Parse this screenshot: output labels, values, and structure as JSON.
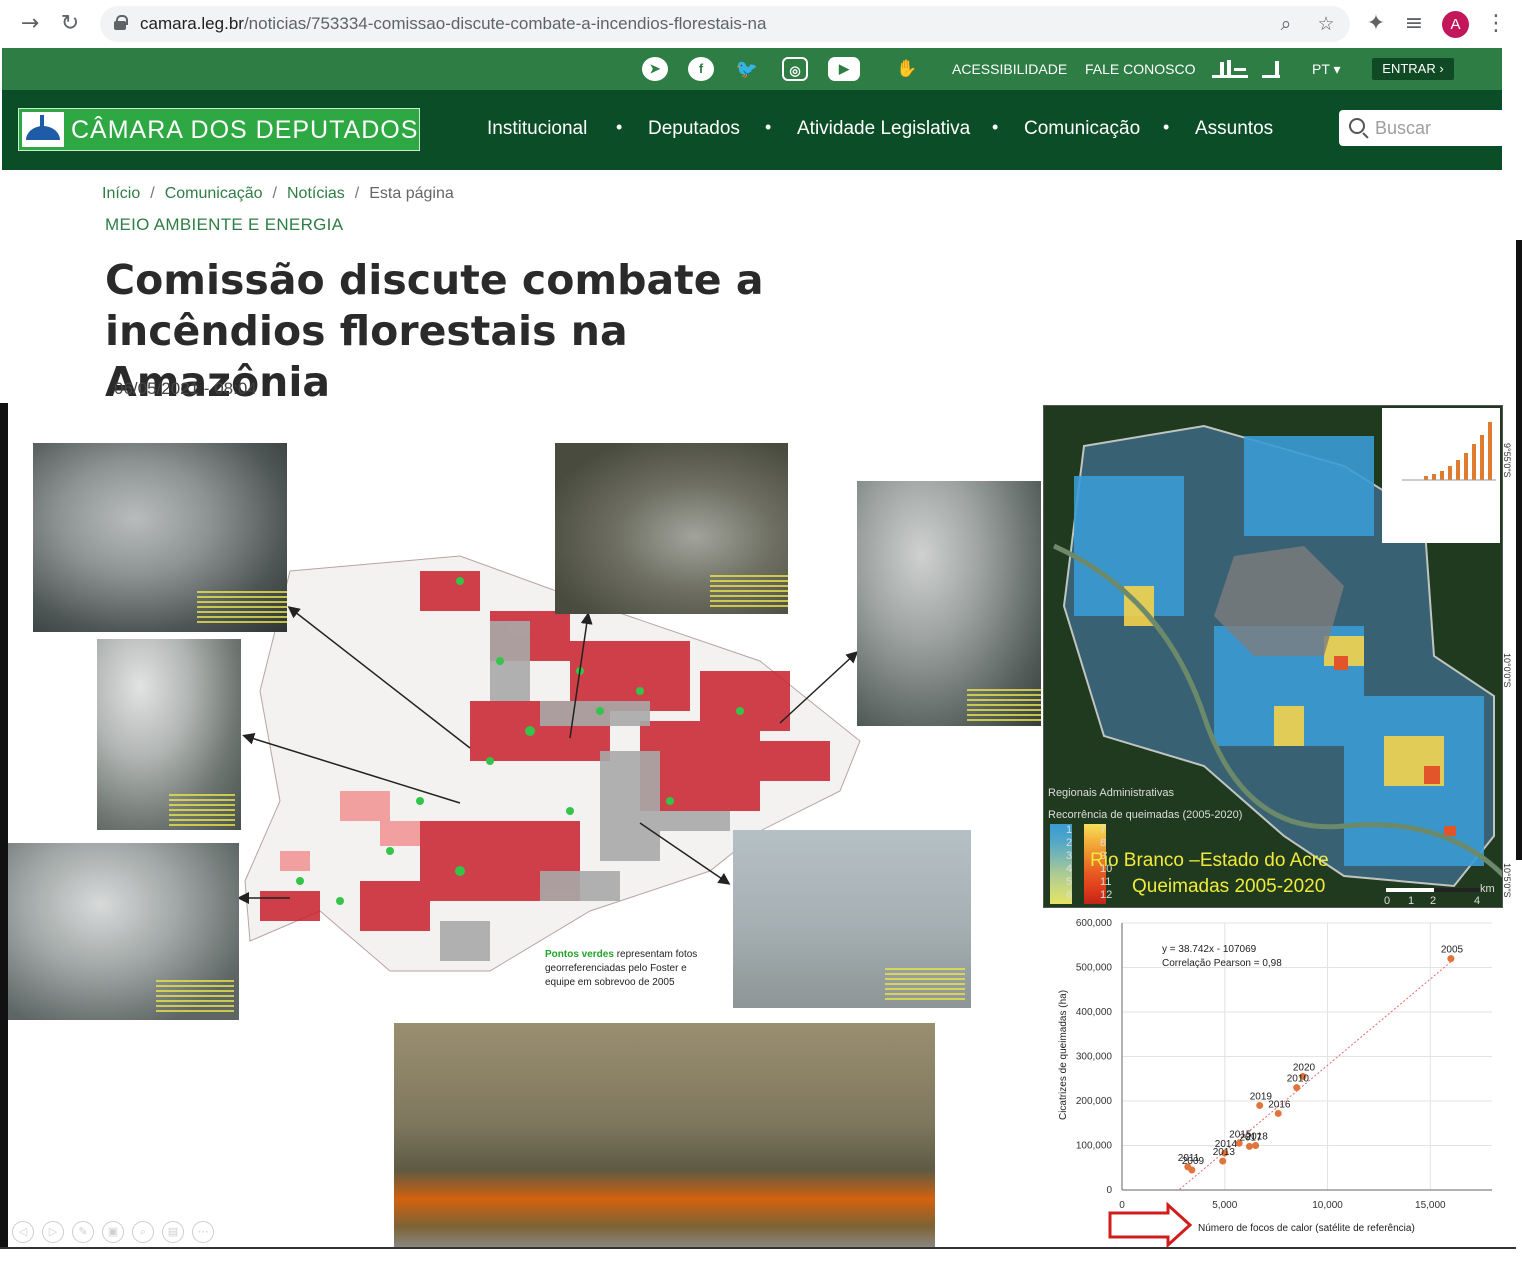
{
  "browser": {
    "url_host": "camara.leg.br",
    "url_path": "/noticias/753334-comissao-discute-combate-a-incendios-florestais-na",
    "avatar_letter": "A"
  },
  "topbar": {
    "social": [
      "telegram-icon",
      "facebook-icon",
      "twitter-icon",
      "instagram-icon",
      "youtube-icon"
    ],
    "accessibility": "ACESSIBILIDADE",
    "contact": "FALE CONOSCO",
    "language": "PT ▾",
    "login": "ENTRAR ›"
  },
  "header": {
    "logo_text": "CÂMARA DOS DEPUTADOS",
    "menu": [
      "Institucional",
      "Deputados",
      "Atividade Legislativa",
      "Comunicação",
      "Assuntos"
    ],
    "search_placeholder": "Buscar"
  },
  "article": {
    "breadcrumb": [
      "Início",
      "Comunicação",
      "Notícias",
      "Esta página"
    ],
    "section": "MEIO AMBIENTE E ENERGIA",
    "title": "Comissão discute combate a incêndios florestais na Amazônia",
    "date": "06/05/2021 - 08:04"
  },
  "slide": {
    "caption_green": "Pontos verdes",
    "caption_rest": " representam fotos georreferenciadas pelo Foster e equipe em sobrevoo de 2005",
    "map_legend_title": "Regionais Administrativas",
    "map_legend_recurrence": "Recorrência de queimadas (2005-2020)",
    "map_legend_values": [
      "1",
      "2",
      "3",
      "4",
      "5",
      "6",
      "7",
      "8",
      "9",
      "10",
      "11",
      "12"
    ],
    "map_title_line1": "Rio Branco –Estado do Acre",
    "map_title_line2": "Queimadas 2005-2020",
    "map_km": "km",
    "map_scale": [
      "0",
      "1",
      "2",
      "4"
    ],
    "map_coords": [
      "9°55'0\"S",
      "10°0'0\"S",
      "10°5'0\"S"
    ]
  },
  "chart_data": {
    "type": "scatter",
    "equation": "y = 38.742x - 107069",
    "correlation": "Correlação Pearson = 0,98",
    "xlabel": "Número de focos de calor (satélite de referência)",
    "ylabel": "Cicatrizes de queimadas (ha)",
    "xlim": [
      0,
      18000
    ],
    "ylim": [
      0,
      600000
    ],
    "xticks": [
      "0",
      "5,000",
      "10,000",
      "15,000"
    ],
    "yticks": [
      "0",
      "100,000",
      "200,000",
      "300,000",
      "400,000",
      "500,000",
      "600,000"
    ],
    "points": [
      {
        "label": "2005",
        "x": 16000,
        "y": 520000
      },
      {
        "label": "2020",
        "x": 8800,
        "y": 255000
      },
      {
        "label": "2010",
        "x": 8500,
        "y": 230000
      },
      {
        "label": "2019",
        "x": 6700,
        "y": 190000
      },
      {
        "label": "2016",
        "x": 7600,
        "y": 172000
      },
      {
        "label": "2015",
        "x": 5700,
        "y": 105000
      },
      {
        "label": "2017",
        "x": 6200,
        "y": 98000
      },
      {
        "label": "2018",
        "x": 6500,
        "y": 100000
      },
      {
        "label": "2014",
        "x": 5000,
        "y": 83000
      },
      {
        "label": "2013",
        "x": 4900,
        "y": 65000
      },
      {
        "label": "2011",
        "x": 3200,
        "y": 52000
      },
      {
        "label": "2009",
        "x": 3400,
        "y": 45000
      }
    ]
  }
}
